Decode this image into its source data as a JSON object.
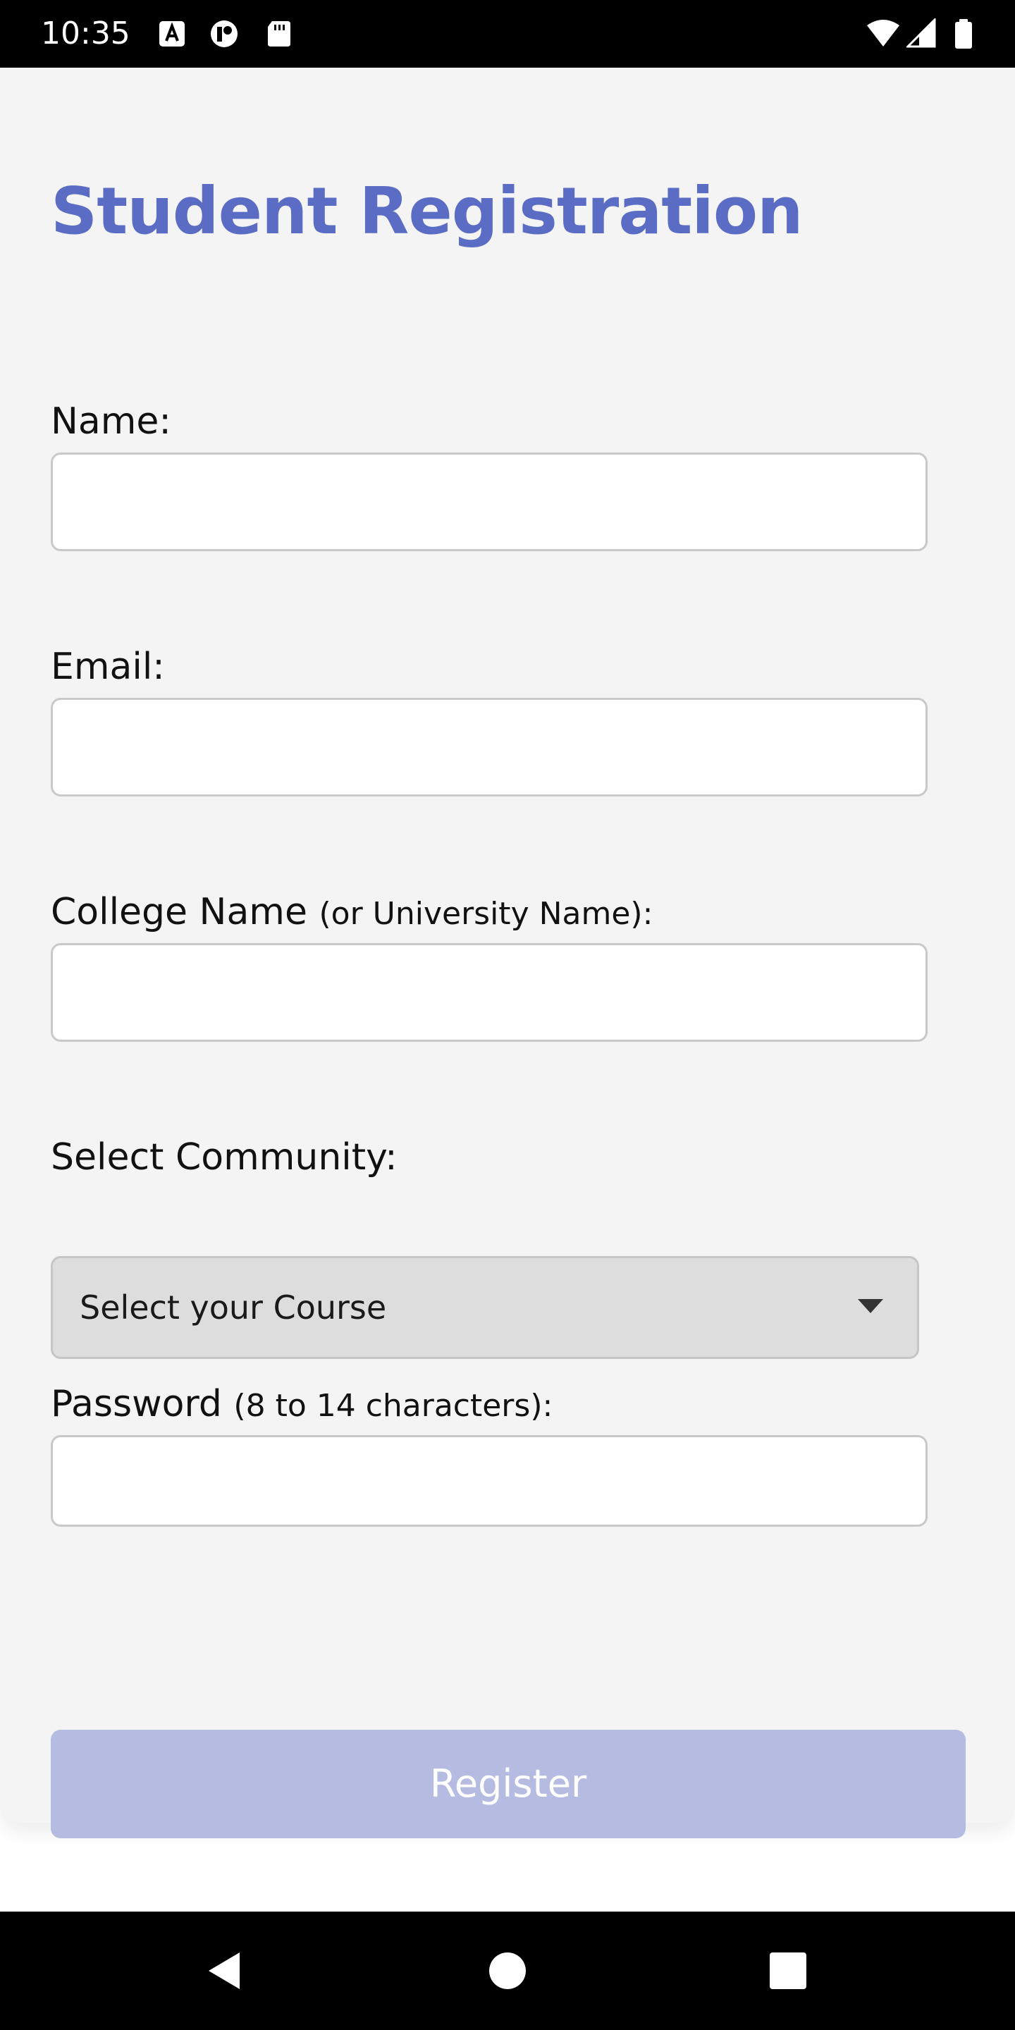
{
  "status_bar": {
    "time": "10:35",
    "left_icons": [
      "a-keyboard-icon",
      "circle-p-icon",
      "sd-card-icon"
    ],
    "right_icons": [
      "wifi-icon",
      "cellular-signal-icon",
      "battery-icon"
    ]
  },
  "form": {
    "title": "Student Registration",
    "name_label": "Name:",
    "name_value": "",
    "email_label": "Email:",
    "email_value": "",
    "college_label_main": "College Name",
    "college_label_sub": "(or University Name):",
    "college_value": "",
    "community_label": "Select Community:",
    "community_select_value": "Select your Course",
    "password_label_main": "Password",
    "password_label_sub": "(8 to 14 characters):",
    "password_value": "",
    "register_label": "Register"
  },
  "nav_bar": {
    "buttons": [
      "back-icon",
      "home-icon",
      "recents-icon"
    ]
  },
  "colors": {
    "title": "#5b6cc5",
    "register_button": "#b5bbe1",
    "card_background": "#f4f4f4",
    "select_background": "#dddddd"
  }
}
